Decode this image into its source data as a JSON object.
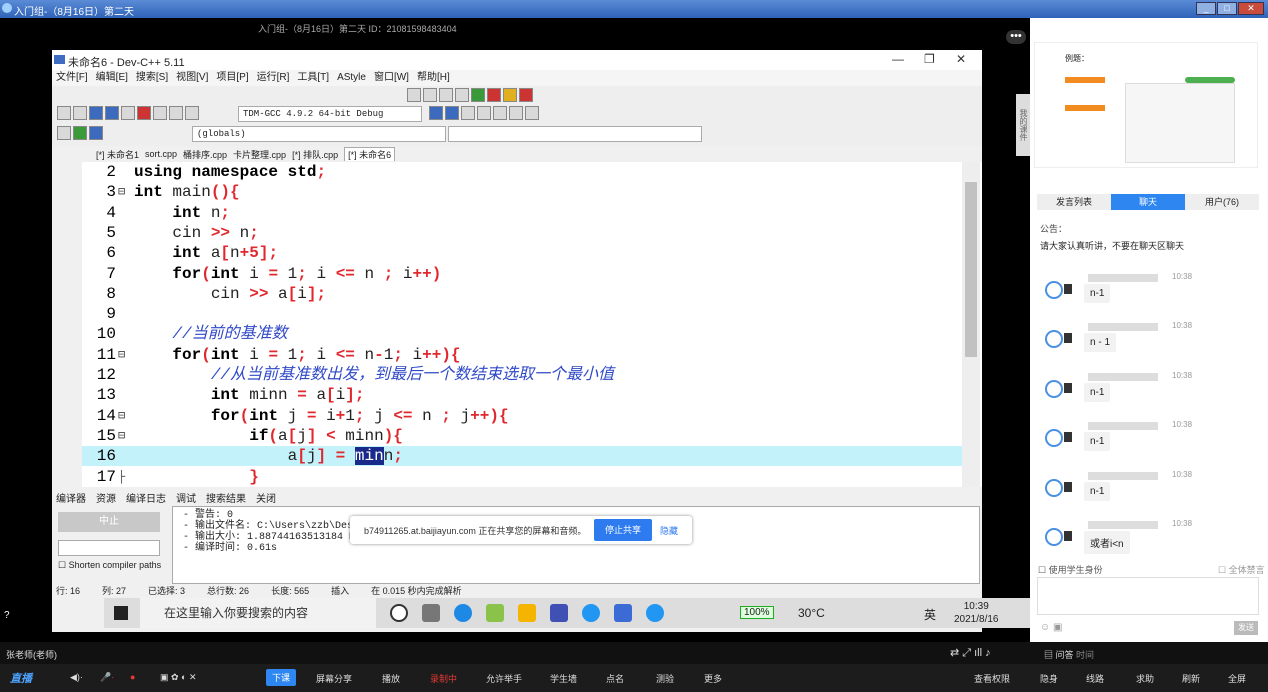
{
  "window": {
    "title": "入门组-（8月16日）第二天",
    "meeting_info": "入门组-（8月16日）第二天      ID：21081598483404"
  },
  "ide": {
    "title": "未命名6 - Dev-C++ 5.11",
    "menu": [
      "文件[F]",
      "编辑[E]",
      "搜索[S]",
      "视图[V]",
      "项目[P]",
      "运行[R]",
      "工具[T]",
      "AStyle",
      "窗口[W]",
      "帮助[H]"
    ],
    "compiler": "TDM-GCC 4.9.2 64-bit Debug",
    "scope": "(globals)",
    "tabs": [
      "[*] 未命名1",
      "sort.cpp",
      "桶排序.cpp",
      "卡片整理.cpp",
      "[*] 排队.cpp",
      "[*] 未命名6"
    ],
    "lines": [
      {
        "n": "2",
        "fold": "",
        "code": [
          {
            "t": "using namespace std",
            "c": "kw"
          },
          {
            "t": ";",
            "c": "op"
          }
        ]
      },
      {
        "n": "3",
        "fold": "⊟",
        "code": [
          {
            "t": "int",
            "c": "kw"
          },
          {
            "t": " main",
            "c": ""
          },
          {
            "t": "(){",
            "c": "op"
          }
        ]
      },
      {
        "n": "4",
        "fold": "",
        "code": [
          {
            "t": "    int",
            "c": "kw"
          },
          {
            "t": " n",
            "c": ""
          },
          {
            "t": ";",
            "c": "op"
          }
        ]
      },
      {
        "n": "5",
        "fold": "",
        "code": [
          {
            "t": "    cin ",
            "c": ""
          },
          {
            "t": ">>",
            "c": "op"
          },
          {
            "t": " n",
            "c": ""
          },
          {
            "t": ";",
            "c": "op"
          }
        ]
      },
      {
        "n": "6",
        "fold": "",
        "code": [
          {
            "t": "    int",
            "c": "kw"
          },
          {
            "t": " a",
            "c": ""
          },
          {
            "t": "[",
            "c": "op"
          },
          {
            "t": "n",
            "c": ""
          },
          {
            "t": "+5];",
            "c": "op"
          }
        ]
      },
      {
        "n": "7",
        "fold": "",
        "code": [
          {
            "t": "    for",
            "c": "kw"
          },
          {
            "t": "(",
            "c": "op"
          },
          {
            "t": "int",
            "c": "kw"
          },
          {
            "t": " i ",
            "c": ""
          },
          {
            "t": "=",
            "c": "op"
          },
          {
            "t": " 1",
            "c": ""
          },
          {
            "t": ";",
            "c": "op"
          },
          {
            "t": " i ",
            "c": ""
          },
          {
            "t": "<=",
            "c": "op"
          },
          {
            "t": " n ",
            "c": ""
          },
          {
            "t": ";",
            "c": "op"
          },
          {
            "t": " i",
            "c": ""
          },
          {
            "t": "++)",
            "c": "op"
          }
        ]
      },
      {
        "n": "8",
        "fold": "",
        "code": [
          {
            "t": "        cin ",
            "c": ""
          },
          {
            "t": ">>",
            "c": "op"
          },
          {
            "t": " a",
            "c": ""
          },
          {
            "t": "[",
            "c": "op"
          },
          {
            "t": "i",
            "c": ""
          },
          {
            "t": "];",
            "c": "op"
          }
        ]
      },
      {
        "n": "9",
        "fold": "",
        "code": []
      },
      {
        "n": "10",
        "fold": "",
        "code": [
          {
            "t": "    //当前的基准数",
            "c": "cm"
          }
        ]
      },
      {
        "n": "11",
        "fold": "⊟",
        "code": [
          {
            "t": "    for",
            "c": "kw"
          },
          {
            "t": "(",
            "c": "op"
          },
          {
            "t": "int",
            "c": "kw"
          },
          {
            "t": " i ",
            "c": ""
          },
          {
            "t": "=",
            "c": "op"
          },
          {
            "t": " 1",
            "c": ""
          },
          {
            "t": ";",
            "c": "op"
          },
          {
            "t": " i ",
            "c": ""
          },
          {
            "t": "<=",
            "c": "op"
          },
          {
            "t": " n",
            "c": ""
          },
          {
            "t": "-",
            "c": "op"
          },
          {
            "t": "1",
            "c": ""
          },
          {
            "t": ";",
            "c": "op"
          },
          {
            "t": " i",
            "c": ""
          },
          {
            "t": "++){",
            "c": "op"
          }
        ]
      },
      {
        "n": "12",
        "fold": "",
        "code": [
          {
            "t": "        //从当前基准数出发，到最后一个数结束选取一个最小值",
            "c": "cm"
          }
        ]
      },
      {
        "n": "13",
        "fold": "",
        "code": [
          {
            "t": "        int",
            "c": "kw"
          },
          {
            "t": " minn ",
            "c": ""
          },
          {
            "t": "=",
            "c": "op"
          },
          {
            "t": " a",
            "c": ""
          },
          {
            "t": "[",
            "c": "op"
          },
          {
            "t": "i",
            "c": ""
          },
          {
            "t": "];",
            "c": "op"
          }
        ]
      },
      {
        "n": "14",
        "fold": "⊟",
        "code": [
          {
            "t": "        for",
            "c": "kw"
          },
          {
            "t": "(",
            "c": "op"
          },
          {
            "t": "int",
            "c": "kw"
          },
          {
            "t": " j ",
            "c": ""
          },
          {
            "t": "=",
            "c": "op"
          },
          {
            "t": " i",
            "c": ""
          },
          {
            "t": "+",
            "c": "op"
          },
          {
            "t": "1",
            "c": ""
          },
          {
            "t": ";",
            "c": "op"
          },
          {
            "t": " j ",
            "c": ""
          },
          {
            "t": "<=",
            "c": "op"
          },
          {
            "t": " n ",
            "c": ""
          },
          {
            "t": ";",
            "c": "op"
          },
          {
            "t": " j",
            "c": ""
          },
          {
            "t": "++){",
            "c": "op"
          }
        ]
      },
      {
        "n": "15",
        "fold": "⊟",
        "code": [
          {
            "t": "            if",
            "c": "kw"
          },
          {
            "t": "(",
            "c": "op"
          },
          {
            "t": "a",
            "c": ""
          },
          {
            "t": "[",
            "c": "op"
          },
          {
            "t": "j",
            "c": ""
          },
          {
            "t": "]",
            "c": "op"
          },
          {
            "t": " ",
            "c": ""
          },
          {
            "t": "<",
            "c": "op"
          },
          {
            "t": " minn",
            "c": ""
          },
          {
            "t": "){",
            "c": "op"
          }
        ]
      },
      {
        "n": "16",
        "fold": "",
        "hl": true,
        "code": [
          {
            "t": "                a",
            "c": ""
          },
          {
            "t": "[",
            "c": "op"
          },
          {
            "t": "j",
            "c": ""
          },
          {
            "t": "]",
            "c": "op"
          },
          {
            "t": " ",
            "c": ""
          },
          {
            "t": "=",
            "c": "op"
          },
          {
            "t": " ",
            "c": ""
          },
          {
            "t": "min",
            "c": "sel"
          },
          {
            "t": "n",
            "c": ""
          },
          {
            "t": ";",
            "c": "op"
          }
        ]
      },
      {
        "n": "17",
        "fold": "├",
        "code": [
          {
            "t": "            }",
            "c": "op"
          }
        ]
      }
    ],
    "bottom_tabs": [
      "编译器",
      "资源",
      "编译日志",
      "调试",
      "搜索结果",
      "关闭"
    ],
    "abort_label": "中止",
    "shorten_label": "Shorten compiler paths",
    "log": "- 警告: 0\n- 输出文件名: C:\\Users\\zzb\\Desktop\\集训课程入门组C++\\数组2\\排队.exe\n- 输出大小: 1.88744163513184 MiB\n- 编译时间: 0.61s",
    "status": {
      "row": "行: 16",
      "col": "列: 27",
      "selected": "已选择: 3",
      "total": "总行数: 26",
      "len": "长度: 565",
      "ins": "插入",
      "parse": "在 0.015 秒内完成解析"
    }
  },
  "share_bar": {
    "text": "b74911265.at.baijiayun.com 正在共享您的屏幕和音频。",
    "stop": "停止共享",
    "hide": "隐藏"
  },
  "taskbar": {
    "search": "在这里输入你要搜索的内容",
    "battery": "100%",
    "weather": "30°C",
    "lang": "英",
    "time": "10:39",
    "date": "2021/8/16"
  },
  "right": {
    "slide_title": "例题：",
    "side_label": "我的课件",
    "tabs": [
      "发言列表",
      "聊天",
      "用户(76)"
    ],
    "notice_label": "公告：",
    "notice": "请大家认真听讲，不要在聊天区聊天",
    "messages": [
      {
        "time": "10:38",
        "text": "n-1"
      },
      {
        "time": "10:38",
        "text": "n - 1"
      },
      {
        "time": "10:38",
        "text": "n-1"
      },
      {
        "time": "10:38",
        "text": "n-1"
      },
      {
        "time": "10:38",
        "text": "n-1"
      },
      {
        "time": "10:38",
        "text": "或者i<n"
      }
    ],
    "anon": "使用学生身份",
    "mute_all": "全体禁言",
    "send": "发送",
    "qa": "问答",
    "time_label": "时间"
  },
  "bottom": {
    "teacher": "张老师(老师)",
    "tools": [
      "屏幕分享",
      "播放",
      "录制中",
      "允许举手",
      "学生墙",
      "点名",
      "测验",
      "更多"
    ],
    "lower": "下课",
    "right_tools": [
      "查看权限",
      "隐身",
      "线路",
      "求助",
      "刷新",
      "全屏"
    ]
  }
}
